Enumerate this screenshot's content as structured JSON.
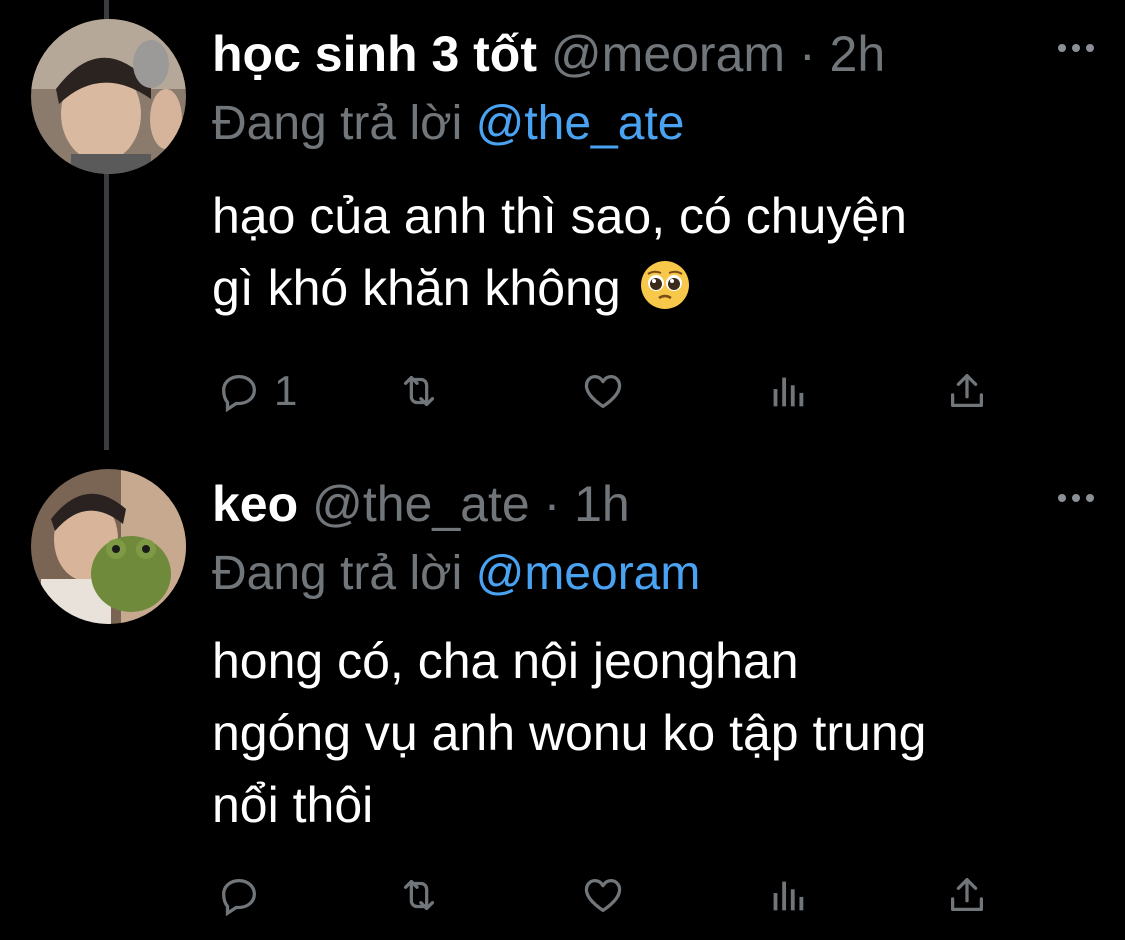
{
  "tweets": [
    {
      "display_name": "học sinh 3 tốt",
      "handle": "@meoram",
      "separator": "·",
      "time": "2h",
      "reply_prefix": "Đang trả lời",
      "reply_mention": "@the_ate",
      "body_line1": "hạo của anh thì sao, có chuyện",
      "body_line2": "gì khó khăn không",
      "body_emoji": "pleading-face-emoji",
      "reply_count": "1",
      "avatar_icon": "avatar-photo"
    },
    {
      "display_name": "keo",
      "handle": "@the_ate",
      "separator": "·",
      "time": "1h",
      "reply_prefix": "Đang trả lời",
      "reply_mention": "@meoram",
      "body_line1": "hong có, cha nội jeonghan",
      "body_line2": "ngóng vụ anh wonu ko tập trung",
      "body_line3": "nổi thôi",
      "reply_count": "",
      "avatar_icon": "avatar-photo"
    }
  ],
  "icons": {
    "reply": "reply-icon",
    "retweet": "retweet-icon",
    "like": "heart-icon",
    "views": "views-icon",
    "share": "share-icon",
    "more": "more-icon"
  },
  "colors": {
    "background": "#000000",
    "primary_text": "#ffffff",
    "secondary_text": "#71767b",
    "mention": "#4aa3f2",
    "thread_line": "#3a3d40"
  }
}
